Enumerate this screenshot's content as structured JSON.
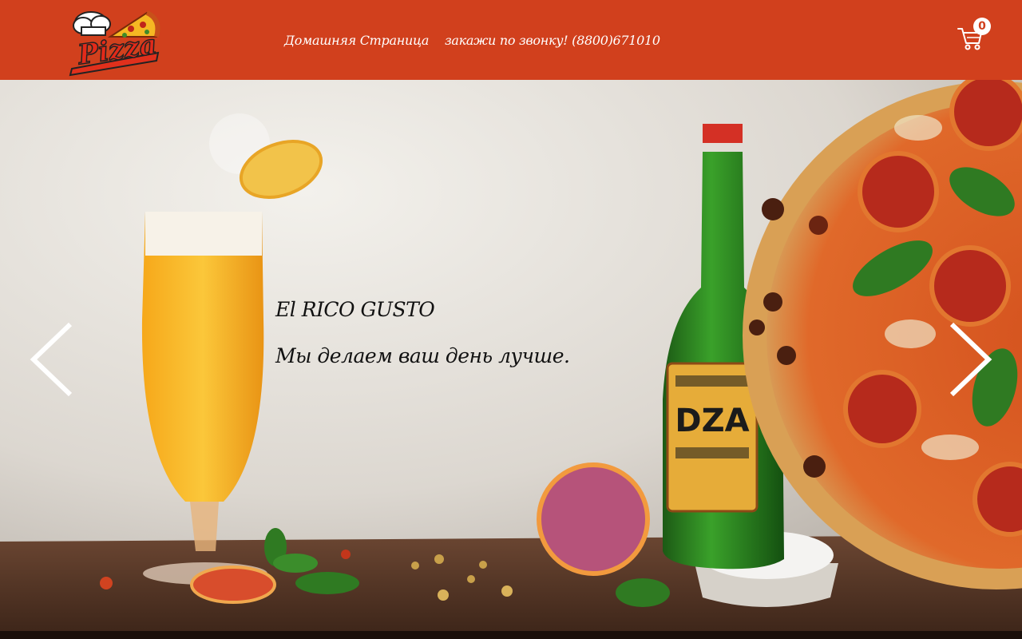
{
  "header": {
    "logo_text": "Pizza",
    "nav": {
      "home_label": "Домашняя Страница",
      "phone_label": "закажи по звонку! (8800)671010"
    },
    "cart": {
      "count": "0"
    }
  },
  "hero": {
    "title": "El RICO GUSTO",
    "subtitle": "Мы делаем ваш день лучше.",
    "bottle_label": "DZA"
  },
  "colors": {
    "header_bg": "#d1401d",
    "text_light": "#ffffff",
    "caption_text": "#111111"
  }
}
